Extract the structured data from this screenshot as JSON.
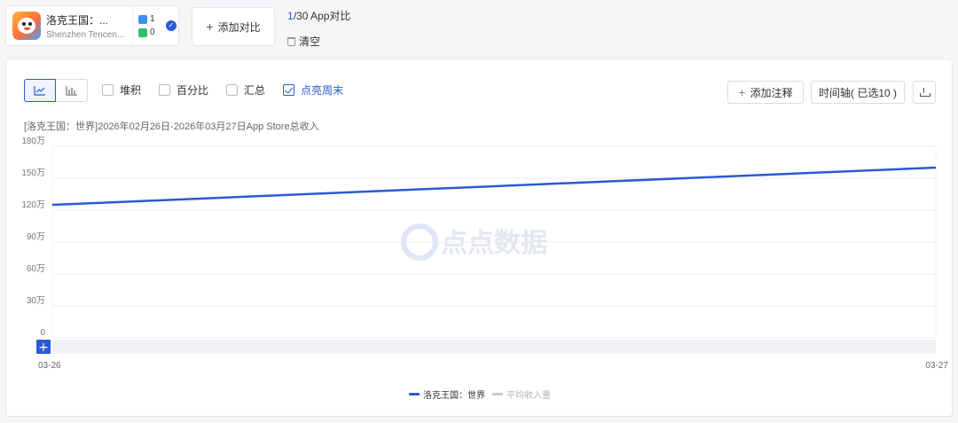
{
  "app_card": {
    "name": "洛克王国：...",
    "developer": "Shenzhen Tencen...",
    "appstore_count": "1",
    "googleplay_count": "0"
  },
  "compare": {
    "add_label": "添加对比",
    "current": "1",
    "total_suffix": "/30 App对比",
    "clear_label": "清空"
  },
  "toolbar": {
    "options": [
      {
        "label": "堆积",
        "checked": false
      },
      {
        "label": "百分比",
        "checked": false
      },
      {
        "label": "汇总",
        "checked": false
      },
      {
        "label": "点亮周末",
        "checked": true
      }
    ],
    "add_annotation": "添加注释",
    "timeline": "时间轴( 已选10 )"
  },
  "chart_title": "[洛克王国：世界]2026年02月26日-2026年03月27日App Store总收入",
  "watermark": "点点数据",
  "colors": {
    "accent": "#2a5ad5",
    "series": "#2a5ad5",
    "avg_series": "#c8cad0"
  },
  "chart_data": {
    "type": "line",
    "x": [
      "03-26",
      "03-27"
    ],
    "series": [
      {
        "name": "洛克王国：世界",
        "values": [
          1250000,
          1600000
        ]
      }
    ],
    "legend": [
      "洛克王国：世界",
      "平均收入量"
    ],
    "yticks": [
      "0",
      "30万",
      "60万",
      "90万",
      "120万",
      "150万",
      "180万"
    ],
    "ylim": [
      0,
      1800000
    ],
    "grid": true,
    "legend_position": "bottom-center"
  }
}
